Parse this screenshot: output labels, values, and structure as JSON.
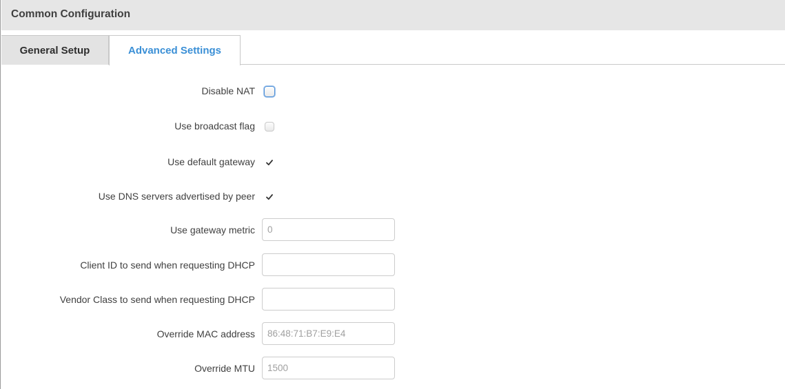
{
  "section": {
    "title": "Common Configuration"
  },
  "tabs": [
    {
      "label": "General Setup",
      "active": false
    },
    {
      "label": "Advanced Settings",
      "active": true
    }
  ],
  "colors": {
    "active_tab": "#3a8fd6",
    "header_bg": "#e6e6e6",
    "focus_ring": "#4c8fd8"
  },
  "fields": {
    "disable_nat": {
      "label": "Disable NAT",
      "checked": false
    },
    "broadcast_flag": {
      "label": "Use broadcast flag",
      "checked": false
    },
    "default_gateway": {
      "label": "Use default gateway",
      "checked": true
    },
    "dns_servers": {
      "label": "Use DNS servers advertised by peer",
      "checked": true
    },
    "gateway_metric": {
      "label": "Use gateway metric",
      "value": "",
      "placeholder": "0"
    },
    "client_id": {
      "label": "Client ID to send when requesting DHCP",
      "value": "",
      "placeholder": ""
    },
    "vendor_class": {
      "label": "Vendor Class to send when requesting DHCP",
      "value": "",
      "placeholder": ""
    },
    "mac_address": {
      "label": "Override MAC address",
      "value": "",
      "placeholder": "86:48:71:B7:E9:E4"
    },
    "mtu": {
      "label": "Override MTU",
      "value": "",
      "placeholder": "1500"
    }
  }
}
